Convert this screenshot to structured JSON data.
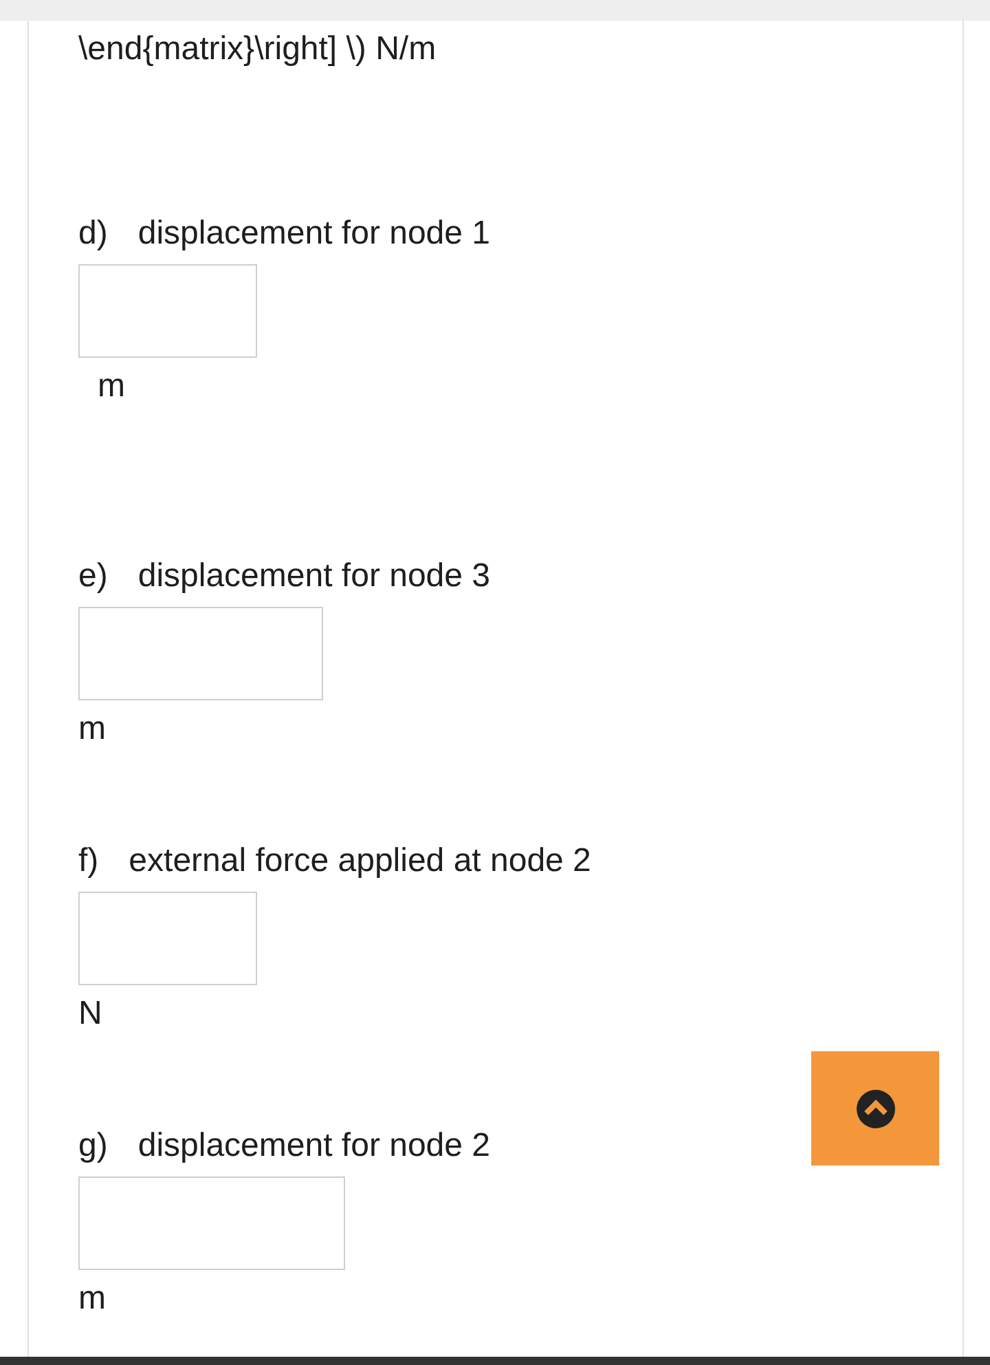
{
  "intro_text": "\\end{matrix}\\right] \\) N/m",
  "questions": [
    {
      "letter": "d)",
      "prompt": "displacement for node 1",
      "unit": "m"
    },
    {
      "letter": "e)",
      "prompt": "displacement for node 3",
      "unit": "m"
    },
    {
      "letter": "f)",
      "prompt": "external force applied at node 2",
      "unit": "N"
    },
    {
      "letter": "g)",
      "prompt": "displacement for node 2",
      "unit": "m"
    }
  ]
}
